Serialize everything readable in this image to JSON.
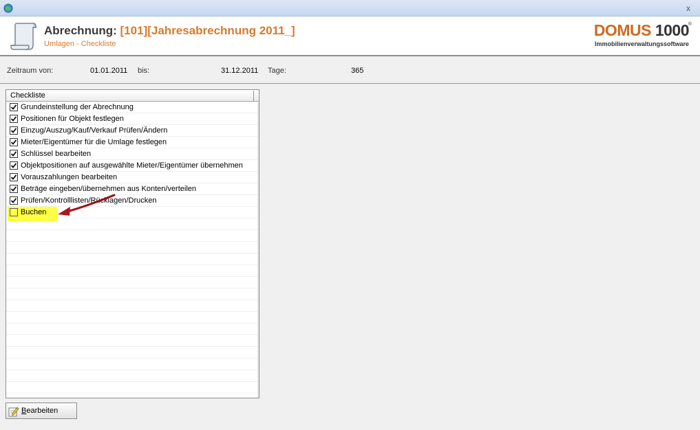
{
  "window": {
    "close_label": "x"
  },
  "header": {
    "title_prefix": "Abrechnung:",
    "title_highlight": "[101][Jahresabrechnung 2011_]",
    "subtitle": "Umlagen - Checkliste",
    "logo": {
      "brand": "DOMUS",
      "number": "1000",
      "reg": "®",
      "tagline": "Immobilienverwaltungssoftware"
    }
  },
  "info": {
    "zeitraum_label": "Zeitraum von:",
    "zeitraum_value": "01.01.2011",
    "bis_label": "bis:",
    "bis_value": "31.12.2011",
    "tage_label": "Tage:",
    "tage_value": "365"
  },
  "checklist": {
    "column_header": "Checkliste",
    "items": [
      {
        "label": "Grundeinstellung der Abrechnung",
        "checked": true
      },
      {
        "label": "Positionen für Objekt festlegen",
        "checked": true
      },
      {
        "label": "Einzug/Auszug/Kauf/Verkauf Prüfen/Ändern",
        "checked": true
      },
      {
        "label": "Mieter/Eigentümer für die Umlage festlegen",
        "checked": true
      },
      {
        "label": "Schlüssel bearbeiten",
        "checked": true
      },
      {
        "label": "Objektpositionen auf ausgewählte Mieter/Eigentümer übernehmen",
        "checked": true
      },
      {
        "label": "Vorauszahlungen bearbeiten",
        "checked": true
      },
      {
        "label": "Beträge eingeben/übernehmen aus Konten/verteilen",
        "checked": true
      },
      {
        "label": "Prüfen/Kontrolllisten/Rücklagen/Drucken",
        "checked": true
      },
      {
        "label": "Buchen",
        "checked": false
      }
    ]
  },
  "buttons": {
    "edit_first": "B",
    "edit_rest": "earbeiten"
  },
  "colors": {
    "accent": "#d97a2a",
    "highlight": "#ffff44",
    "arrow": "#b0141b"
  }
}
